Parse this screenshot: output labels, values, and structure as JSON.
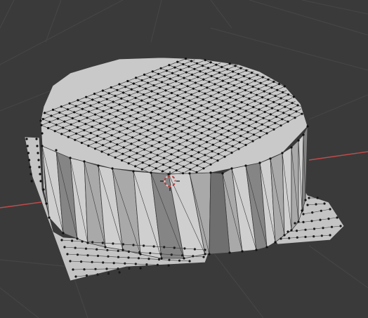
{
  "viewport": {
    "background": "#3a3a3a",
    "grid_color": "#454545",
    "x_axis_color": "#c04b4b",
    "mesh_face_color": "#c8c8c8",
    "mesh_side_light": "#cfcfcf",
    "mesh_side_mid": "#a9a9a9",
    "mesh_side_dark": "#858585",
    "edge_color": "#3b3b3b",
    "vertex_color": "#111111",
    "cursor_icon": "3d-cursor-icon"
  }
}
